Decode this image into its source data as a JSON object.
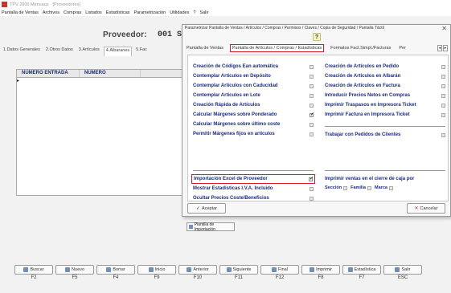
{
  "window": {
    "title": "TPV 2000 Menuaus · [Proveedores]",
    "menu": [
      "Pantalla de Ventas",
      "Archivos",
      "Compras",
      "Listados",
      "Estadísticas",
      "Parametrización",
      "Utilidades",
      "?",
      "Salir"
    ]
  },
  "header": {
    "proveedor_label": "Proveedor:",
    "proveedor_value": "001 SUM"
  },
  "tabs": [
    "1.Datos Generales",
    "2.Otros Datos",
    "3.Artículos",
    "4.Albaranes",
    "5.Fac"
  ],
  "active_tab_index": 3,
  "grid": {
    "columns": [
      "NUMERO ENTRADA",
      "NUMERO"
    ],
    "row_marker": "▸"
  },
  "function_keys": [
    {
      "label": "Buscar",
      "key": "F2"
    },
    {
      "label": "Nuevo",
      "key": "F5"
    },
    {
      "label": "Borrar",
      "key": "F4"
    },
    {
      "label": "Inicio",
      "key": "F9"
    },
    {
      "label": "Anterior",
      "key": "F10"
    },
    {
      "label": "Siguiente",
      "key": "F11"
    },
    {
      "label": "Final",
      "key": "F12"
    },
    {
      "label": "Imprimir",
      "key": "F8"
    },
    {
      "label": "Estadística",
      "key": "F7"
    },
    {
      "label": "Salir",
      "key": "ESC"
    }
  ],
  "dialog": {
    "title": "Parametrizar Pantalla de Ventas / Artículos / Compras / Permisos / Claves / Copia de Seguridad / Pantalla Táctil",
    "close": "✕",
    "help": "?",
    "tabs": [
      "Pantalla de Ventas",
      "Pantalla de Artículos / Compras / Estadísticas",
      "Formatos Fact.Simpl./Facturas",
      "Per"
    ],
    "active_tab_index": 1,
    "left_options": [
      {
        "label": "Creación de Códigos Ean automática",
        "checked": false
      },
      {
        "label": "Contemplar Artículos en Depósito",
        "checked": false
      },
      {
        "label": "Contemplar Artículos con Caducidad",
        "checked": false
      },
      {
        "label": "Contemplar Artículos en Lote",
        "checked": false
      },
      {
        "label": "Creación Rápida de Artículos",
        "checked": false
      },
      {
        "label": "Calcular Márgenes sobre Ponderado",
        "checked": true
      },
      {
        "label": "Calcular Márgenes sobre último coste",
        "checked": false
      },
      {
        "label": "Permitir Márgenes fijos en artículos",
        "checked": false
      }
    ],
    "right_options": [
      {
        "label": "Creación de Artículos en Pedido",
        "checked": false
      },
      {
        "label": "Creación de Artículos en Albarán",
        "checked": false
      },
      {
        "label": "Creación de Artículos en Factura",
        "checked": false
      },
      {
        "label": "Introducir Precios Netos en Compras",
        "checked": false
      },
      {
        "label": "Imprimir Traspasos en Impresora Ticket",
        "checked": false
      },
      {
        "label": "Imprimir Factura en Impresora Ticket",
        "checked": false
      }
    ],
    "right_extra": {
      "label": "Trabajar con Pedidos de Clientes",
      "checked": false
    },
    "lower_left": [
      {
        "label": "Importación Excel de Proveedor",
        "checked": true,
        "highlight": true
      },
      {
        "label": "Mostrar Estadísticas I.V.A. Incluido",
        "checked": false
      },
      {
        "label": "Ocultar Precios Coste/Beneficios",
        "checked": false
      }
    ],
    "lower_right": {
      "label": "Imprimir ventas en el cierre de caja por",
      "choices": [
        "Sección",
        "Familia",
        "Marca"
      ]
    },
    "accept_label": "Aceptar",
    "cancel_label": "Cancelar"
  },
  "import_button": "Plantilla de Importación"
}
